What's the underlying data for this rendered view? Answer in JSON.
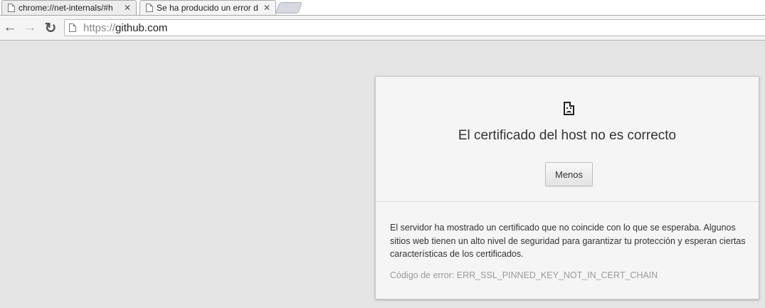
{
  "tabs": [
    {
      "title": "chrome://net-internals/#h",
      "close_label": "✕",
      "active": false
    },
    {
      "title": "Se ha producido un error d",
      "close_label": "✕",
      "active": true
    }
  ],
  "toolbar": {
    "back_icon": "←",
    "forward_icon": "→",
    "reload_icon": "↻",
    "url_scheme": "https://",
    "url_host": "github.com"
  },
  "interstitial": {
    "icon": "broken-document-icon",
    "title": "El certificado del host no es correcto",
    "less_button": "Menos",
    "details": "El servidor ha mostrado un certificado que no coincide con lo que se esperaba. Algunos sitios web tienen un alto nivel de seguridad para garantizar tu protección y esperan ciertas características de los certificados.",
    "error_code": "Código de error: ERR_SSL_PINNED_KEY_NOT_IN_CERT_CHAIN"
  },
  "colors": {
    "page_background": "#e5e5e5",
    "card_background": "#f5f5f5",
    "title_text": "#333333",
    "error_code_text": "#9a9a9a"
  }
}
